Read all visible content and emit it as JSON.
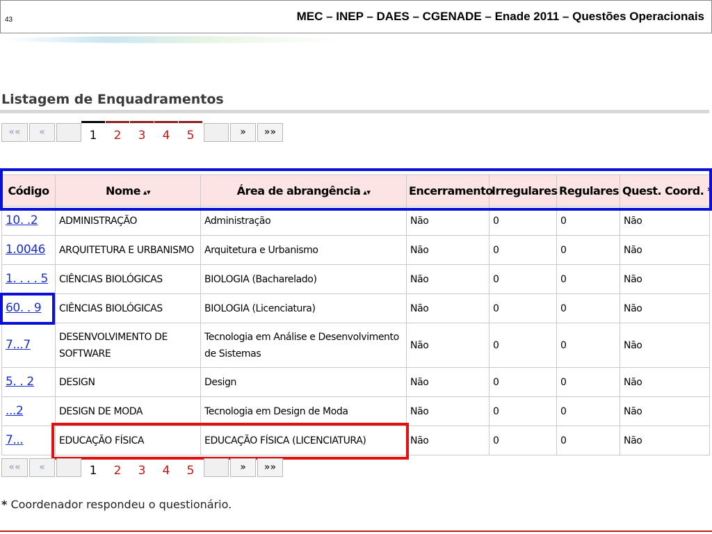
{
  "slide": {
    "number": "43",
    "title": "MEC – INEP – DAES – CGENADE – Enade 2011 – Questões Operacionais"
  },
  "page": {
    "heading": "Listagem de Enquadramentos",
    "footnote_star": "*",
    "footnote_text": " Coordenador respondeu o questionário."
  },
  "pager": {
    "first": "««",
    "prev": "«",
    "next": "»",
    "last": "»»",
    "pages": [
      "1",
      "2",
      "3",
      "4",
      "5"
    ],
    "current": "1"
  },
  "table": {
    "headers": {
      "codigo": "Código",
      "nome": "Nome",
      "area": "Área de abrangência",
      "encerramento": "Encerramento",
      "irregulares": "Irregulares",
      "regulares": "Regulares",
      "quest": "Quest. Coord. *"
    },
    "sort_icon": "sort-arrows-icon",
    "rows": [
      {
        "codigo": "10. .2",
        "nome": "ADMINISTRAÇÃO",
        "area": "Administração",
        "encerramento": "Não",
        "irregulares": "0",
        "regulares": "0",
        "quest": "Não"
      },
      {
        "codigo": "1.0046",
        "nome": "ARQUITETURA E URBANISMO",
        "area": "Arquitetura e Urbanismo",
        "encerramento": "Não",
        "irregulares": "0",
        "regulares": "0",
        "quest": "Não"
      },
      {
        "codigo": "1. . . . 5",
        "nome": "CIÊNCIAS BIOLÓGICAS",
        "area": "BIOLOGIA (Bacharelado)",
        "encerramento": "Não",
        "irregulares": "0",
        "regulares": "0",
        "quest": "Não"
      },
      {
        "codigo": "60. . 9",
        "nome": "CIÊNCIAS BIOLÓGICAS",
        "area": "BIOLOGIA (Licenciatura)",
        "encerramento": "Não",
        "irregulares": "0",
        "regulares": "0",
        "quest": "Não"
      },
      {
        "codigo": "7...7",
        "nome": "DESENVOLVIMENTO DE SOFTWARE",
        "area": "Tecnologia em Análise e Desenvolvimento de Sistemas",
        "encerramento": "Não",
        "irregulares": "0",
        "regulares": "0",
        "quest": "Não"
      },
      {
        "codigo": "5. . 2",
        "nome": "DESIGN",
        "area": "Design",
        "encerramento": "Não",
        "irregulares": "0",
        "regulares": "0",
        "quest": "Não"
      },
      {
        "codigo": "...2",
        "nome": "DESIGN DE MODA",
        "area": "Tecnologia em Design de Moda",
        "encerramento": "Não",
        "irregulares": "0",
        "regulares": "0",
        "quest": "Não"
      },
      {
        "codigo": "7...",
        "nome": "EDUCAÇÃO FÍSICA",
        "area": "EDUCAÇÃO FÍSICA (LICENCIATURA)",
        "encerramento": "Não",
        "irregulares": "0",
        "regulares": "0",
        "quest": "Não"
      }
    ]
  },
  "colors": {
    "highlight_blue": "#0a10d8",
    "highlight_red": "#e41010",
    "header_bg": "#fde4e4",
    "link": "#1a2fc8",
    "page_link": "#c01818"
  }
}
